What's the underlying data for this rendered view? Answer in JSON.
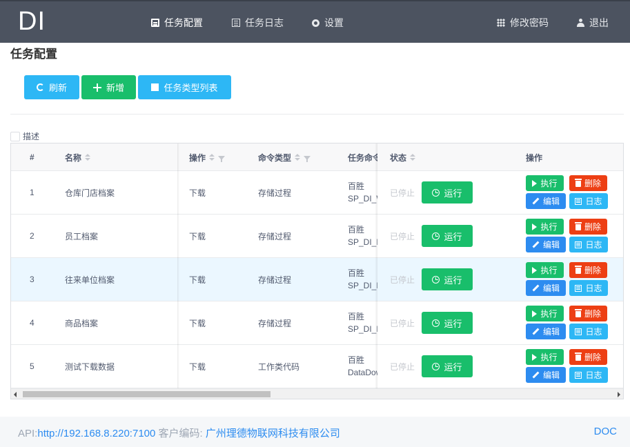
{
  "header": {
    "logo": "DI",
    "nav": [
      {
        "label": "任务配置",
        "icon": "list-icon"
      },
      {
        "label": "任务日志",
        "icon": "document-icon"
      },
      {
        "label": "设置",
        "icon": "gear-icon"
      }
    ],
    "right_nav": [
      {
        "label": "修改密码",
        "icon": "grid-icon"
      },
      {
        "label": "退出",
        "icon": "user-icon"
      }
    ]
  },
  "page": {
    "title": "任务配置"
  },
  "toolbar": {
    "refresh": "刷新",
    "add": "新增",
    "task_types": "任务类型列表"
  },
  "filter": {
    "description_label": "描述"
  },
  "table": {
    "columns": {
      "index": "#",
      "name": "名称",
      "operation": "操作",
      "command_type": "命令类型",
      "task_command": "任务命令",
      "status": "状态",
      "actions": "操作"
    },
    "rows": [
      {
        "index": "1",
        "name": "仓库门店档案",
        "operation": "下载",
        "command_type": "存储过程",
        "cmd_line1": "百胜",
        "cmd_line2": "SP_DI_W",
        "status": "已停止"
      },
      {
        "index": "2",
        "name": "员工档案",
        "operation": "下载",
        "command_type": "存储过程",
        "cmd_line1": "百胜",
        "cmd_line2": "SP_DI_E",
        "status": "已停止"
      },
      {
        "index": "3",
        "name": "往来单位档案",
        "operation": "下载",
        "command_type": "存储过程",
        "cmd_line1": "百胜",
        "cmd_line2": "SP_DI_E",
        "status": "已停止"
      },
      {
        "index": "4",
        "name": "商品档案",
        "operation": "下载",
        "command_type": "存储过程",
        "cmd_line1": "百胜",
        "cmd_line2": "SP_DI_E",
        "status": "已停止"
      },
      {
        "index": "5",
        "name": "测试下载数据",
        "operation": "下载",
        "command_type": "工作类代码",
        "cmd_line1": "百胜",
        "cmd_line2": "DataDow",
        "status": "已停止"
      }
    ],
    "buttons": {
      "run": "运行",
      "execute": "执行",
      "delete": "删除",
      "edit": "编辑",
      "log": "日志"
    }
  },
  "footer": {
    "api_label": "API:",
    "api_url": "http://192.168.8.220:7100",
    "client_label": " 客户编码: ",
    "client_name": "广州理德物联网科技有限公司",
    "doc": "DOC"
  }
}
